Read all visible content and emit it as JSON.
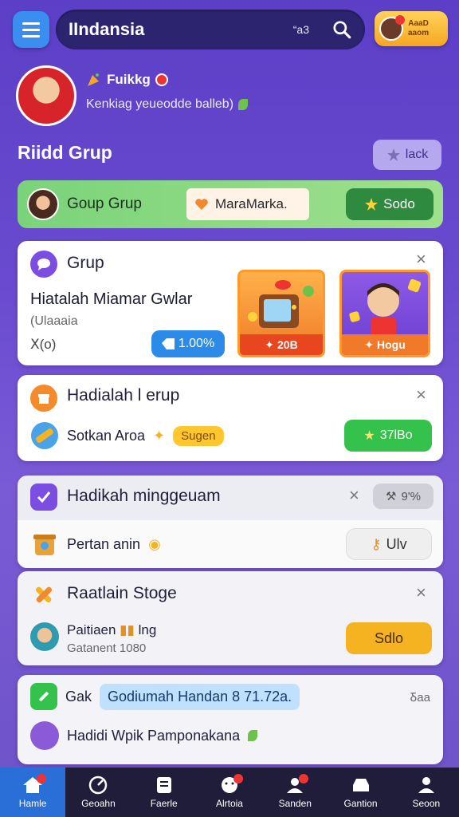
{
  "header": {
    "title": "IIndansia",
    "count": "“a3",
    "coin_text_1": "AaaD",
    "coin_text_2": "aaom"
  },
  "profile": {
    "name": "Fuikkg",
    "subtitle": "Kenkiag yeueodde balleb)"
  },
  "section": {
    "title": "Riidd Grup",
    "link_label": "lack"
  },
  "group_row": {
    "name": "Goup Grup",
    "pill": "MaraMarka.",
    "button": "Sodo"
  },
  "card1": {
    "title": "Grup",
    "subtitle": "Hiatalah Miamar Gwlar",
    "meta1": "(Ulaaaia",
    "meta2": "ꓫ(o)",
    "percent": "1.00%",
    "prize1_label": "20B",
    "prize2_label": "Hogu"
  },
  "card2": {
    "title": "Hadialah l erup",
    "row_text": "Sotkan Aroa",
    "tag": "Sugen",
    "button": "37lBo"
  },
  "card3": {
    "title": "Hadikah minggeuam",
    "pill": "9'%",
    "row_text": "Pertan anin",
    "button": "Ulv"
  },
  "card4": {
    "title": "Raatlain Stoge",
    "line1": "Paitiaen",
    "line1_suffix": "lng",
    "line2": "Gatanent 1080",
    "button": "Sdlo"
  },
  "card5": {
    "row1_prefix": "Gak",
    "row1_highlight": "Godiumah Handan 8 71.72a.",
    "count": "Ᵹaa",
    "row2": "Hadidi Wpik Pamponakana"
  },
  "nav": [
    {
      "label": "Hamle"
    },
    {
      "label": "Geoahn"
    },
    {
      "label": "Faerle"
    },
    {
      "label": "Alrtoia"
    },
    {
      "label": "Sanden"
    },
    {
      "label": "Gantion"
    },
    {
      "label": "Seoon"
    }
  ],
  "colors": {
    "background": "#5b3fc6",
    "accent_blue": "#2c8be8",
    "accent_green": "#35c24c",
    "accent_orange": "#f5b321",
    "nav_bg": "#1f1d3a"
  }
}
